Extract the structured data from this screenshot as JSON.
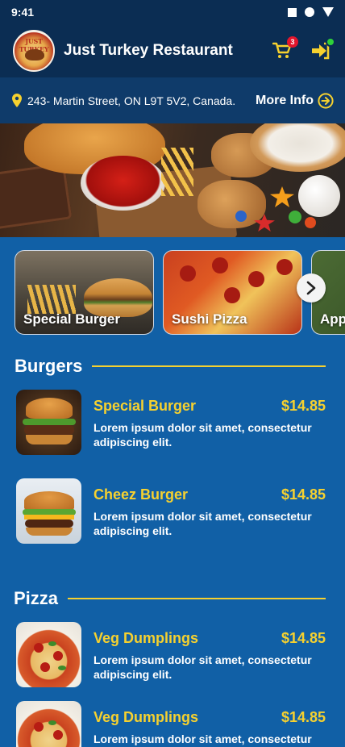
{
  "status_bar": {
    "time": "9:41"
  },
  "header": {
    "title": "Just Turkey Restaurant",
    "logo_text": "JUST TURKEY",
    "cart_count": "3",
    "accent_color": "#f6d12f"
  },
  "address": {
    "text": "243- Martin Street, ON L9T 5V2, Canada.",
    "more_info_label": "More Info"
  },
  "categories": [
    {
      "label": "Special Burger"
    },
    {
      "label": "Sushi Pizza"
    },
    {
      "label": "App"
    }
  ],
  "sections": [
    {
      "title": "Burgers",
      "items": [
        {
          "name": "Special Burger",
          "price": "$14.85",
          "description": "Lorem ipsum dolor sit amet, consectetur adipiscing elit."
        },
        {
          "name": "Cheez Burger",
          "price": "$14.85",
          "description": "Lorem ipsum dolor sit amet, consectetur adipiscing elit."
        }
      ]
    },
    {
      "title": "Pizza",
      "items": [
        {
          "name": "Veg Dumplings",
          "price": "$14.85",
          "description": "Lorem ipsum dolor sit amet, consectetur adipiscing elit."
        },
        {
          "name": "Veg Dumplings",
          "price": "$14.85",
          "description": "Lorem ipsum dolor sit amet, consectetur adipiscing elit."
        }
      ]
    }
  ],
  "icons": {
    "cart": "cart-icon",
    "login": "login-arrow-icon",
    "location": "location-pin-icon",
    "more_info": "arrow-right-circle-icon",
    "carousel_next": "chevron-right-icon"
  }
}
